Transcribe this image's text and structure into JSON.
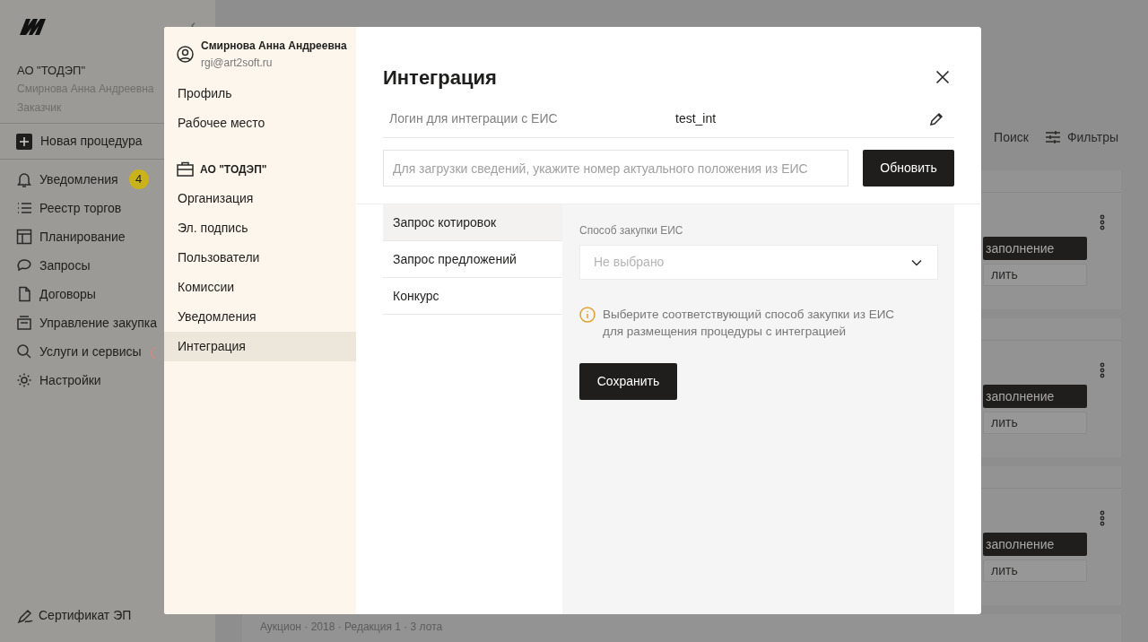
{
  "sidebar": {
    "collapse": "‹",
    "org": "АО \"ТОДЭП\"",
    "user": "Смирнова Анна Андреевна",
    "role": "Заказчик",
    "new_procedure": "Новая процедура",
    "items": [
      {
        "label": "Уведомления",
        "badge": "4"
      },
      {
        "label": "Реестр торгов"
      },
      {
        "label": "Планирование"
      },
      {
        "label": "Запросы"
      },
      {
        "label": "Договоры"
      },
      {
        "label": "Управление закупка"
      },
      {
        "label": "Услуги и сервисы"
      },
      {
        "label": "Настройки"
      }
    ],
    "footer": "Сертификат ЭП"
  },
  "toolbar": {
    "search": "Поиск",
    "filters": "Фильтры"
  },
  "cards": [
    {
      "primary": "заполнение",
      "secondary": "лить"
    },
    {
      "primary": "заполнение",
      "secondary": "лить"
    },
    {
      "primary": "заполнение",
      "secondary": "лить"
    }
  ],
  "bottom_card": {
    "meta": "Аукцион · 2018 · Редакция 1 · 3 лота"
  },
  "modal": {
    "user": {
      "name": "Смирнова Анна Андреевна",
      "email": "rgi@art2soft.ru"
    },
    "personal_items": [
      {
        "label": "Профиль",
        "selected": false
      },
      {
        "label": "Рабочее место",
        "selected": false
      }
    ],
    "org": "АО \"ТОДЭП\"",
    "org_items": [
      {
        "label": "Организация",
        "selected": false
      },
      {
        "label": "Эл. подпись",
        "selected": false
      },
      {
        "label": "Пользователи",
        "selected": false
      },
      {
        "label": "Комиссии",
        "selected": false
      },
      {
        "label": "Уведомления",
        "selected": false
      },
      {
        "label": "Интеграция",
        "selected": true
      }
    ],
    "title": "Интеграция",
    "login_label": "Логин для интеграции с ЕИС",
    "login_value": "test_int",
    "position_field": {
      "placeholder": "Для загрузки сведений, укажите номер актуального положения из ЕИС"
    },
    "update_button": "Обновить",
    "tabs": [
      {
        "label": "Запрос котировок",
        "selected": true
      },
      {
        "label": "Запрос предложений",
        "selected": false
      },
      {
        "label": "Конкурс",
        "selected": false
      }
    ],
    "method_label": "Способ закупки ЕИС",
    "method_select": {
      "placeholder": "Не выбрано"
    },
    "hint": "Выберите соответствующий способ закупки из ЕИС для размещения процедуры с интеграцией",
    "save_button": "Сохранить"
  }
}
